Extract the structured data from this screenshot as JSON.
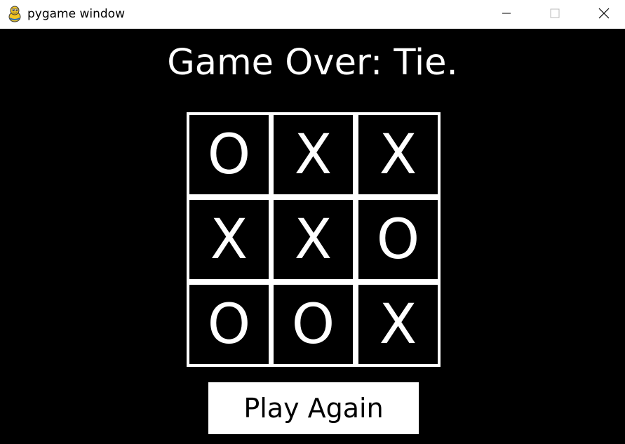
{
  "window": {
    "title": "pygame window",
    "app_icon": "pygame-snake-icon",
    "controls": {
      "minimize_icon": "minimize-icon",
      "maximize_icon": "maximize-icon",
      "close_icon": "close-icon"
    }
  },
  "game": {
    "status": "Game Over: Tie.",
    "board": [
      [
        "O",
        "X",
        "X"
      ],
      [
        "X",
        "X",
        "O"
      ],
      [
        "O",
        "O",
        "X"
      ]
    ],
    "play_again_label": "Play Again"
  },
  "colors": {
    "background": "#000000",
    "foreground": "#ffffff",
    "titlebar": "#ffffff"
  }
}
